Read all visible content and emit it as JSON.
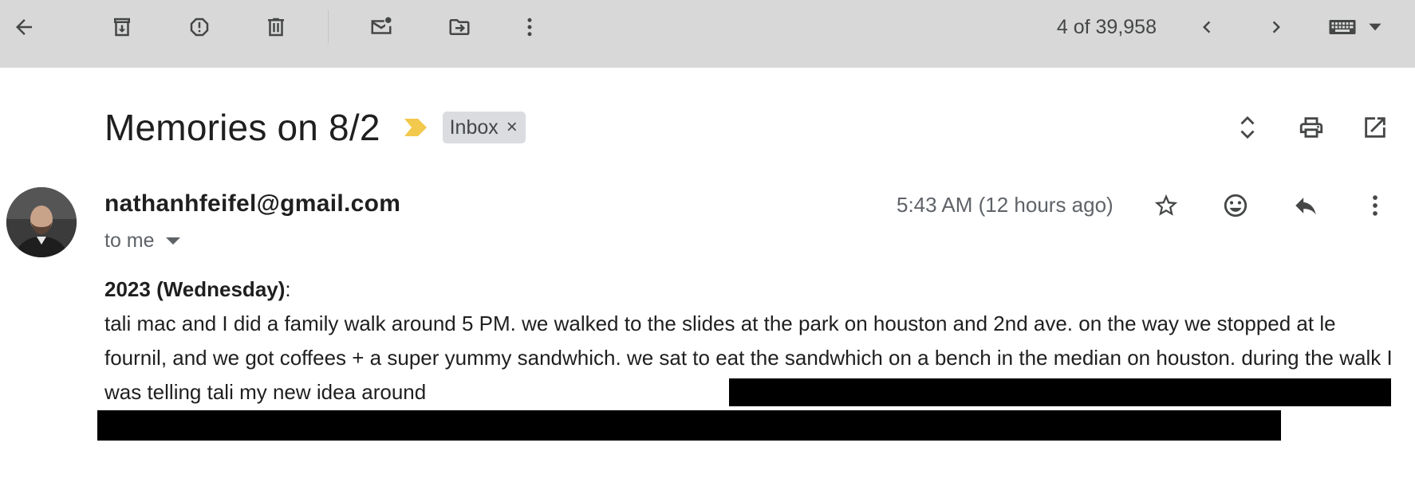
{
  "toolbar": {
    "counter": "4 of 39,958",
    "icons": [
      "back-arrow-icon",
      "archive-icon",
      "report-spam-icon",
      "delete-icon",
      "mark-unread-icon",
      "move-to-icon",
      "more-vert-icon",
      "newer-icon",
      "older-icon",
      "keyboard-icon",
      "dropdown-icon"
    ]
  },
  "email": {
    "subject": "Memories on 8/2",
    "label": "Inbox",
    "label_remove": "×",
    "sender": "nathanhfeifel@gmail.com",
    "recipient": "to me",
    "timestamp": "5:43 AM (12 hours ago)",
    "body": {
      "date_heading": "2023 (Wednesday)",
      "date_suffix": ":",
      "paragraph": "tali mac and I did a family walk around 5 PM. we walked to the slides at the park on houston and 2nd ave. on the way we stopped at le fournil, and we got coffees + a super yummy sandwhich. we sat to eat the sandwhich on a bench in the median on houston. during the walk I was telling tali my new idea around"
    }
  },
  "colors": {
    "toolbar_bg": "#d8d8d8",
    "importance_marker": "#f2c94c",
    "chip_bg": "#dadce0",
    "redaction": "#000000"
  }
}
